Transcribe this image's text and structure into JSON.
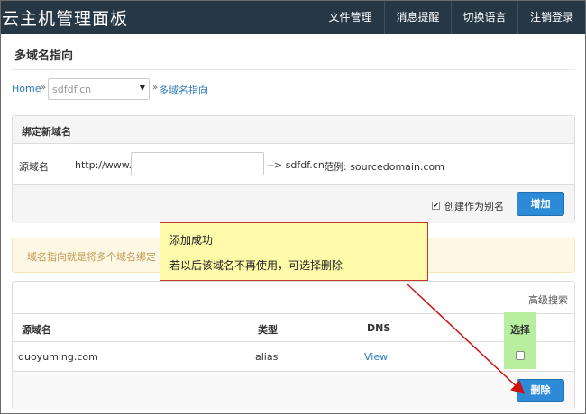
{
  "header": {
    "brand": "云主机管理面板",
    "nav": [
      "文件管理",
      "消息提醒",
      "切换语言",
      "注销登录"
    ]
  },
  "page": {
    "title": "多域名指向"
  },
  "breadcrumb": {
    "home": "Home",
    "separator": "»",
    "selected_domain": "sdfdf.cn",
    "current": "多域名指向"
  },
  "bind_form": {
    "heading": "绑定新域名",
    "source_label": "源域名",
    "prefix": "http://www.",
    "input_value": "",
    "suffix": "--> sdfdf.cn",
    "example": "范例: sourcedomain.com",
    "alias_checked": true,
    "alias_label": "创建作为别名",
    "add_button": "增加"
  },
  "info": {
    "text": "域名指向就是将多个域名绑定"
  },
  "tooltip": {
    "line1": "添加成功",
    "line2": "若以后该域名不再使用，可选择删除"
  },
  "table": {
    "advanced_search": "高级搜索",
    "columns": {
      "source": "源域名",
      "type": "类型",
      "dns": "DNS",
      "select": "选择"
    },
    "rows": [
      {
        "source": "duoyuming.com",
        "type": "alias",
        "dns": "View",
        "selected": false
      }
    ],
    "delete_button": "删除"
  },
  "colors": {
    "topbar": "#263746",
    "link": "#2a7ab8",
    "button": "#2d8ad6",
    "alert_bg": "#fcf8e3",
    "alert_text": "#c09853",
    "tooltip_bg": "#fffbaa",
    "tooltip_border": "#c0392b",
    "highlight": "#b8ef9e",
    "arrow": "#cc1111"
  }
}
